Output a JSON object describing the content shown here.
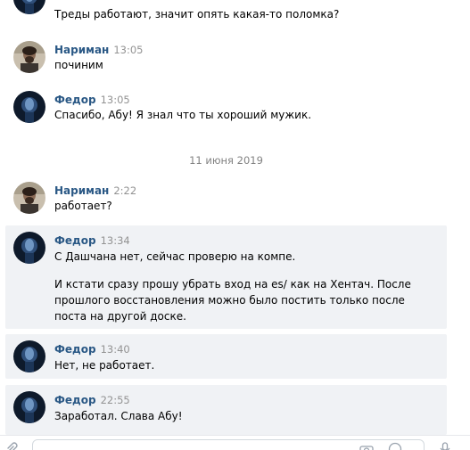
{
  "messages": [
    {
      "author": "",
      "time": "",
      "text": "Треды работают, значит опять какая-то поломка?",
      "avatar": "fedor"
    },
    {
      "author": "Нариман",
      "time": "13:05",
      "text": "починим",
      "avatar": "nariman"
    },
    {
      "author": "Федор",
      "time": "13:05",
      "text": "Спасибо, Абу! Я знал что ты хороший мужик.",
      "avatar": "fedor"
    },
    {
      "author": "Нариман",
      "time": "2:22",
      "text": "работает?",
      "avatar": "nariman"
    },
    {
      "author": "Федор",
      "time": "13:34",
      "text": "С Дашчана нет, сейчас проверю на компе.",
      "text2": "И кстати сразу прошу убрать вход на es/ как на Хентач. После прошлого восстановления можно было постить только после поста на другой доске.",
      "avatar": "fedor",
      "highlight": true
    },
    {
      "author": "Федор",
      "time": "13:40",
      "text": "Нет, не работает.",
      "avatar": "fedor",
      "highlight": true
    },
    {
      "author": "Федор",
      "time": "22:55",
      "text": "Заработал. Слава Абу!",
      "avatar": "fedor",
      "highlight": true
    }
  ],
  "date_separator": "11 июня 2019",
  "icons": {
    "attach": "paperclip-icon",
    "emoji": "smile-icon",
    "voice": "microphone-icon"
  },
  "colors": {
    "author": "#2a5885",
    "time": "#939393",
    "highlight_bg": "#f0f2f5",
    "date": "#828282"
  }
}
